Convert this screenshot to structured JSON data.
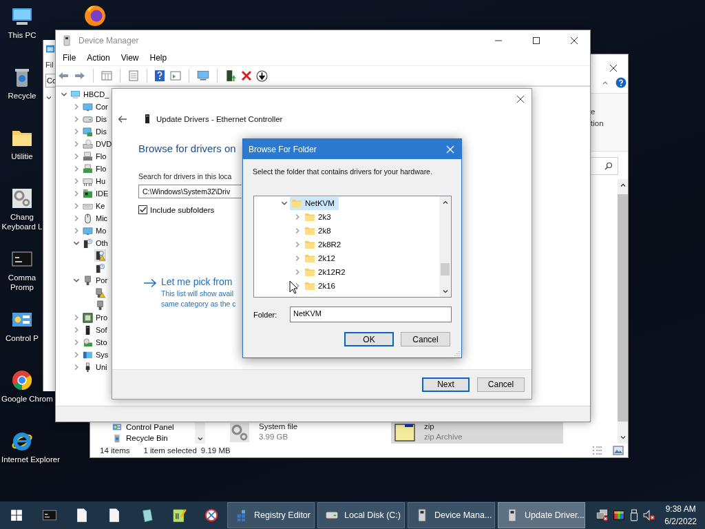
{
  "desktop": {
    "top_icon": {
      "kind": "browser-fox"
    },
    "icons": [
      {
        "kind": "computer",
        "label_lines": [
          "This PC"
        ]
      },
      {
        "kind": "trash-bin",
        "label_lines": [
          "Recycle"
        ]
      },
      {
        "kind": "folder",
        "label_lines": [
          "Utilitie"
        ]
      },
      {
        "kind": "gears",
        "label_lines": [
          "Chang",
          "Keyboard L"
        ]
      },
      {
        "kind": "terminal",
        "label_lines": [
          "Comma",
          "Promp"
        ]
      },
      {
        "kind": "control-panel",
        "label_lines": [
          "Control P"
        ]
      },
      {
        "kind": "browser-ring",
        "label_lines": [
          "Google Chrom"
        ]
      },
      {
        "kind": "browser-e",
        "label_lines": [
          "Internet Explorer"
        ]
      }
    ]
  },
  "explorer_behind": {
    "menu_fragment": "Fil",
    "address_fragment": "Co"
  },
  "explorer": {
    "ribbon_fragments": [
      "e",
      "tion"
    ],
    "nav_items": [
      {
        "name": "Control Panel",
        "kind": "control-panel"
      },
      {
        "name": "Recycle Bin",
        "kind": "trash-bin"
      }
    ],
    "files": [
      {
        "kind": "gears",
        "lines": [
          "System file",
          "3.99 GB"
        ],
        "selected": false
      },
      {
        "kind": "zip-archive",
        "lines": [
          "zip",
          "zip Archive"
        ],
        "selected": true
      }
    ],
    "status": {
      "count": "14 items",
      "selection": "1 item selected",
      "size": "9.19 MB"
    }
  },
  "device_manager": {
    "title": "Device Manager",
    "menu": [
      "File",
      "Action",
      "View",
      "Help"
    ],
    "tree": {
      "label": "HBCD_",
      "kind": "computer",
      "expanded": true,
      "selected": false,
      "children": [
        {
          "label": "Cor",
          "kind": "monitor",
          "expanded": false,
          "selected": false
        },
        {
          "label": "Dis",
          "kind": "drive",
          "expanded": false,
          "selected": false
        },
        {
          "label": "Dis",
          "kind": "display-board",
          "expanded": false,
          "selected": false
        },
        {
          "label": "DVD",
          "kind": "disc-drive",
          "expanded": false,
          "selected": false
        },
        {
          "label": "Flo",
          "kind": "floppy",
          "expanded": false,
          "selected": false
        },
        {
          "label": "Flo",
          "kind": "floppy-board",
          "expanded": false,
          "selected": false
        },
        {
          "label": "Hu",
          "kind": "hid",
          "expanded": false,
          "selected": false
        },
        {
          "label": "IDE",
          "kind": "board",
          "expanded": false,
          "selected": false
        },
        {
          "label": "Ke",
          "kind": "keyboard",
          "expanded": false,
          "selected": false
        },
        {
          "label": "Mic",
          "kind": "mouse",
          "expanded": false,
          "selected": false
        },
        {
          "label": "Mo",
          "kind": "monitor",
          "expanded": false,
          "selected": false
        },
        {
          "label": "Oth",
          "kind": "unknown",
          "expanded": true,
          "selected": false,
          "children": [
            {
              "kind": "warning-device",
              "selected": true
            },
            {
              "kind": "unknown",
              "selected": false
            }
          ]
        },
        {
          "label": "Por",
          "kind": "plug",
          "expanded": true,
          "selected": false,
          "children": [
            {
              "kind": "warning-plug",
              "selected": false
            },
            {
              "kind": "plug",
              "selected": false
            }
          ]
        },
        {
          "label": "Pro",
          "kind": "chip",
          "expanded": false,
          "selected": false
        },
        {
          "label": "Sof",
          "kind": "tower",
          "expanded": false,
          "selected": false
        },
        {
          "label": "Sto",
          "kind": "storage",
          "expanded": false,
          "selected": false
        },
        {
          "label": "Sys",
          "kind": "system",
          "expanded": false,
          "selected": false
        },
        {
          "label": "Uni",
          "kind": "usb",
          "expanded": false,
          "selected": false
        }
      ]
    }
  },
  "update_dialog": {
    "title": "Update Drivers - Ethernet Controller",
    "heading": "Browse for drivers on",
    "search_label": "Search for drivers in this loca",
    "path": "C:\\Windows\\System32\\Driv",
    "include_subfolders": {
      "label": "Include subfolders",
      "checked": true
    },
    "pick": {
      "title": "Let me pick from",
      "lines": [
        "This list will show avail",
        "same category as the c"
      ]
    },
    "buttons": [
      {
        "label": "Next",
        "default": true
      },
      {
        "label": "Cancel",
        "default": false
      }
    ]
  },
  "browse_dialog": {
    "title": "Browse For Folder",
    "instruction": "Select the folder that contains drivers for your hardware.",
    "tree": [
      {
        "label": "NetKVM",
        "selected": true,
        "expanded": true,
        "children": [
          {
            "label": "2k3",
            "selected": false,
            "expanded": false
          },
          {
            "label": "2k8",
            "selected": false,
            "expanded": false
          },
          {
            "label": "2k8R2",
            "selected": false,
            "expanded": false
          },
          {
            "label": "2k12",
            "selected": false,
            "expanded": false
          },
          {
            "label": "2k12R2",
            "selected": false,
            "expanded": false
          },
          {
            "label": "2k16",
            "selected": false,
            "expanded": false
          }
        ]
      }
    ],
    "folder_label": "Folder:",
    "folder_value": "NetKVM",
    "buttons": [
      {
        "label": "OK",
        "default": true
      },
      {
        "label": "Cancel",
        "default": false
      }
    ]
  },
  "taskbar": {
    "tasks": [
      {
        "label": "Registry Editor",
        "kind": "registry",
        "selected": false
      },
      {
        "label": "Local Disk (C:)",
        "kind": "drive",
        "selected": false
      },
      {
        "label": "Device Mana...",
        "kind": "device",
        "selected": false
      },
      {
        "label": "Update Driver...",
        "kind": "device",
        "selected": true
      }
    ],
    "clock": {
      "time": "9:38 AM",
      "date": "6/2/2022"
    }
  }
}
